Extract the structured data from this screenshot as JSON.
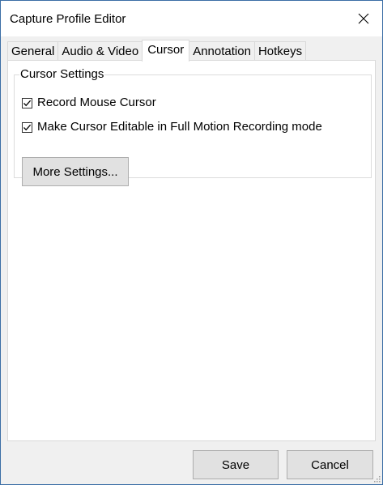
{
  "window": {
    "title": "Capture Profile Editor",
    "close_icon": "close-icon"
  },
  "tabs": [
    {
      "label": "General",
      "active": false
    },
    {
      "label": "Audio & Video",
      "active": false
    },
    {
      "label": "Cursor",
      "active": true
    },
    {
      "label": "Annotation",
      "active": false
    },
    {
      "label": "Hotkeys",
      "active": false
    }
  ],
  "cursor_settings": {
    "group_label": "Cursor Settings",
    "record_mouse_cursor": {
      "label": "Record Mouse Cursor",
      "checked": true
    },
    "make_cursor_editable": {
      "label": "Make Cursor Editable in Full Motion Recording mode",
      "checked": true
    },
    "more_settings_label": "More Settings..."
  },
  "footer": {
    "save_label": "Save",
    "cancel_label": "Cancel"
  }
}
